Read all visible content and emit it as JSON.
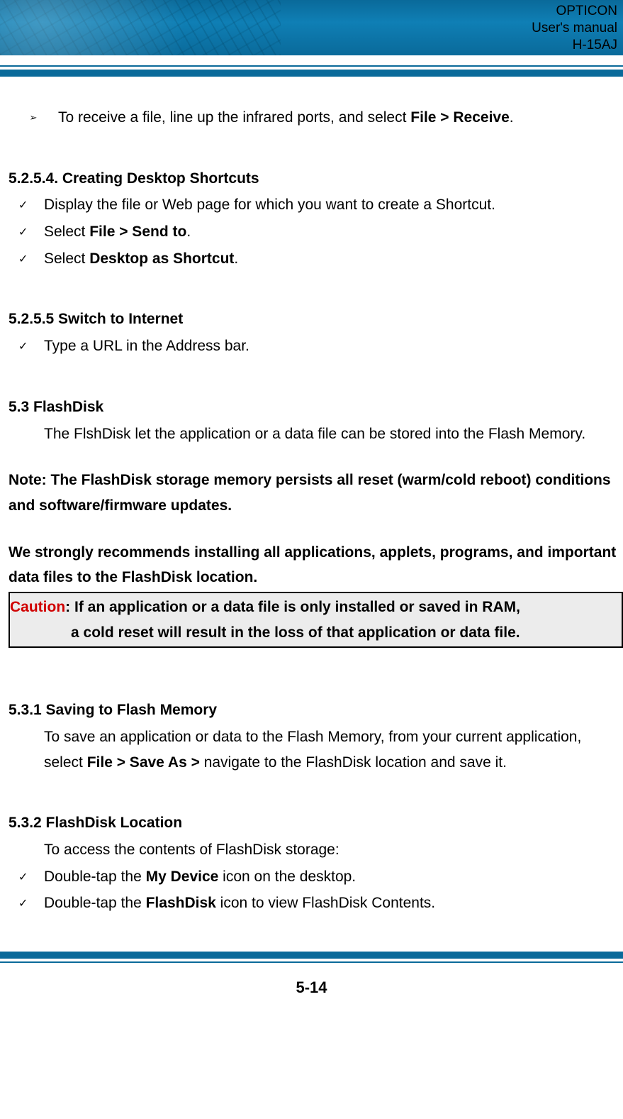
{
  "header": {
    "line1": "OPTICON",
    "line2": "User's manual",
    "line3": "H-15AJ"
  },
  "intro_bullet": {
    "pre": "To receive a file, line up the infrared ports, and select ",
    "bold": "File > Receive",
    "post": "."
  },
  "sections": {
    "shortcuts": {
      "heading": "5.2.5.4. Creating Desktop Shortcuts",
      "items": [
        {
          "plain": "Display the file or Web page for which you want to create a Shortcut."
        },
        {
          "pre": "Select ",
          "bold": "File > Send to",
          "post": "."
        },
        {
          "pre": "Select ",
          "bold": "Desktop as Shortcut",
          "post": "."
        }
      ]
    },
    "internet": {
      "heading": "5.2.5.5 Switch to Internet",
      "items": [
        {
          "plain": "Type a URL in the Address bar."
        }
      ]
    },
    "flashdisk": {
      "heading": "5.3 FlashDisk",
      "body": "The FlshDisk let the application or a data file can be stored into the Flash Memory."
    },
    "note": "Note: The FlashDisk storage memory persists all reset (warm/cold reboot) conditions and software/firmware updates.",
    "recommend": "We strongly recommends installing all applications, applets, programs, and important data files to the FlashDisk location.",
    "caution": {
      "label": "Caution",
      "line1": ": If an application or a data file is only installed or saved in RAM,",
      "line2": "a cold reset will result in the loss of that application or data file."
    },
    "save_flash": {
      "heading": "5.3.1 Saving to Flash Memory",
      "body_pre": "To save an application or data to the Flash Memory, from your current application, select ",
      "body_bold": "File > Save As >",
      "body_post": " navigate to the FlashDisk location and save it."
    },
    "flash_location": {
      "heading": "5.3.2 FlashDisk Location",
      "intro": "To access the contents of FlashDisk storage:",
      "items": [
        {
          "pre": "Double-tap the ",
          "bold": "My Device",
          "post": " icon on the desktop."
        },
        {
          "pre": "Double-tap the ",
          "bold": "FlashDisk",
          "post": " icon to view FlashDisk Contents."
        }
      ]
    }
  },
  "page_number": "5-14",
  "glyphs": {
    "arrow": "➢",
    "check": "✓"
  }
}
